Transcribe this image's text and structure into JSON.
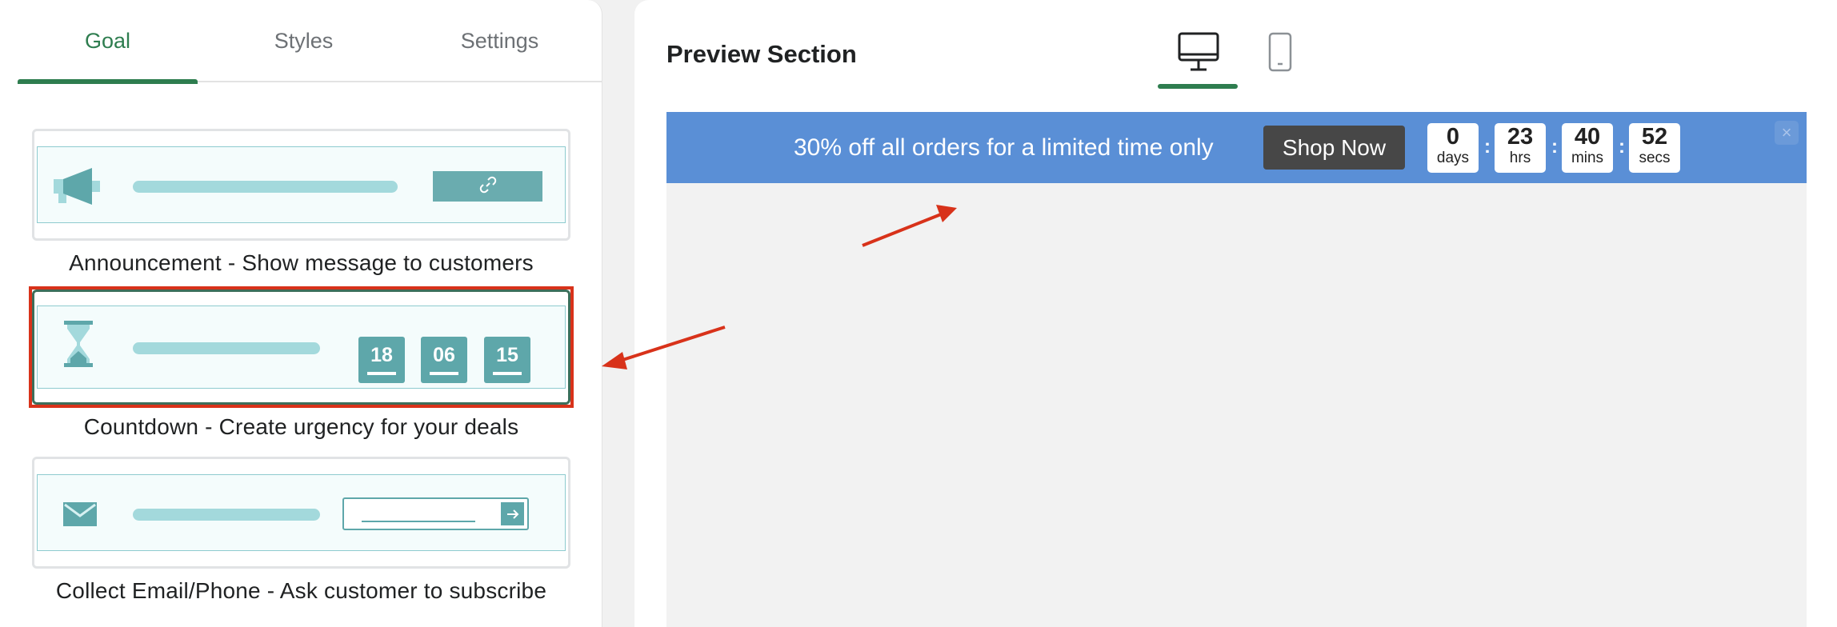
{
  "tabs": [
    {
      "label": "Goal",
      "active": true
    },
    {
      "label": "Styles",
      "active": false
    },
    {
      "label": "Settings",
      "active": false
    }
  ],
  "goals": [
    {
      "caption": "Announcement - Show message to customers",
      "icon": "megaphone-icon"
    },
    {
      "caption": "Countdown - Create urgency for your deals",
      "icon": "hourglass-icon",
      "digits": [
        "18",
        "06",
        "15"
      ],
      "selected": true
    },
    {
      "caption": "Collect Email/Phone - Ask customer to subscribe",
      "icon": "envelope-icon"
    }
  ],
  "preview": {
    "title": "Preview Section",
    "active_device": "desktop",
    "devices": [
      "desktop-icon",
      "mobile-icon"
    ]
  },
  "banner": {
    "message": "30% off all orders for a limited time only",
    "button_label": "Shop Now",
    "countdown": [
      {
        "value": "0",
        "unit": "days"
      },
      {
        "value": "23",
        "unit": "hrs"
      },
      {
        "value": "40",
        "unit": "mins"
      },
      {
        "value": "52",
        "unit": "secs"
      }
    ],
    "separator": ":",
    "close_symbol": "×"
  },
  "colors": {
    "accent_green": "#2e7d4f",
    "banner_bg": "#5a8fd6",
    "button_bg": "#474747",
    "annotation_red": "#d8321a",
    "teal": "#5ea7aa"
  }
}
